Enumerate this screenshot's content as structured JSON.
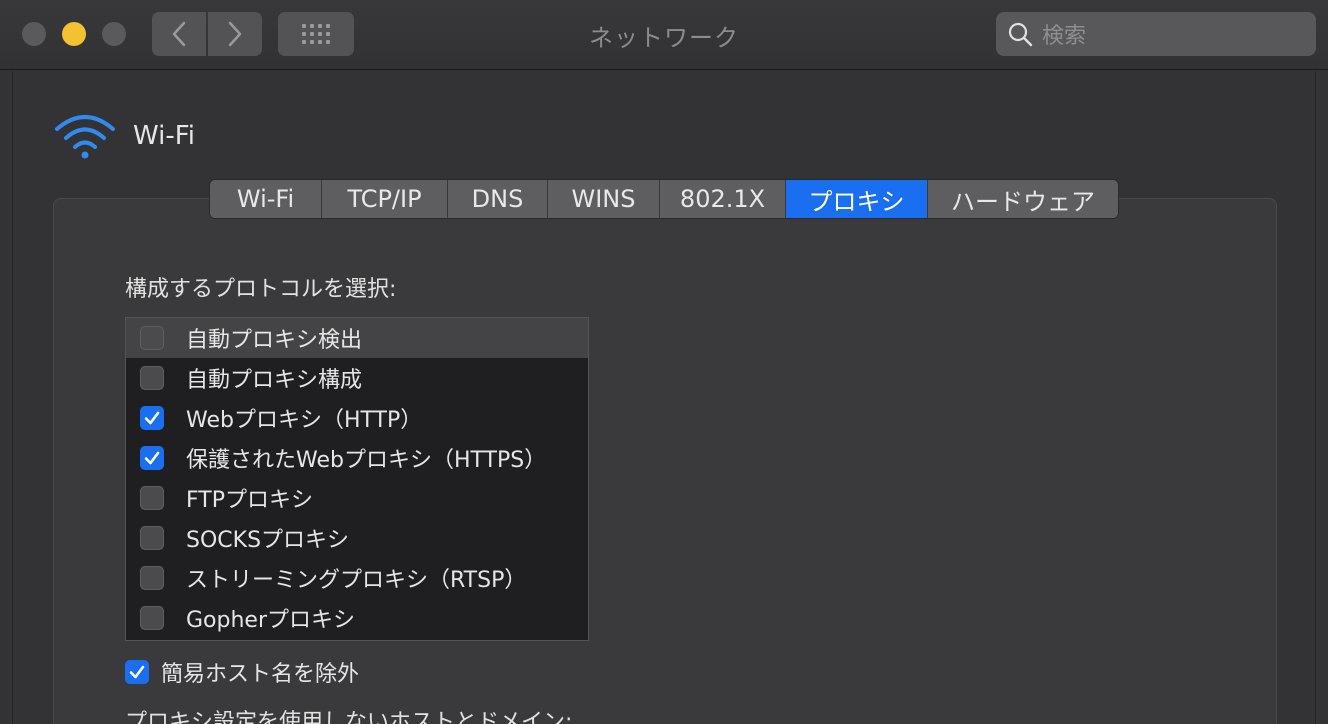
{
  "window": {
    "title": "ネットワーク",
    "search": {
      "placeholder": "検索"
    }
  },
  "interface": {
    "name": "Wi-Fi",
    "icon": "wifi-icon"
  },
  "tabs": [
    {
      "label": "Wi-Fi",
      "active": false
    },
    {
      "label": "TCP/IP",
      "active": false
    },
    {
      "label": "DNS",
      "active": false
    },
    {
      "label": "WINS",
      "active": false
    },
    {
      "label": "802.1X",
      "active": false
    },
    {
      "label": "プロキシ",
      "active": true
    },
    {
      "label": "ハードウェア",
      "active": false
    }
  ],
  "proxy": {
    "section_label": "構成するプロトコルを選択:",
    "protocols": [
      {
        "label": "自動プロキシ検出",
        "checked": false,
        "selected": true
      },
      {
        "label": "自動プロキシ構成",
        "checked": false,
        "selected": false
      },
      {
        "label": "Webプロキシ（HTTP）",
        "checked": true,
        "selected": false
      },
      {
        "label": "保護されたWebプロキシ（HTTPS）",
        "checked": true,
        "selected": false
      },
      {
        "label": "FTPプロキシ",
        "checked": false,
        "selected": false
      },
      {
        "label": "SOCKSプロキシ",
        "checked": false,
        "selected": false
      },
      {
        "label": "ストリーミングプロキシ（RTSP）",
        "checked": false,
        "selected": false
      },
      {
        "label": "Gopherプロキシ",
        "checked": false,
        "selected": false
      }
    ],
    "exclude_simple": {
      "label": "簡易ホスト名を除外",
      "checked": true
    },
    "bypass_label": "プロキシ設定を使用しないホストとドメイン:"
  },
  "colors": {
    "accent": "#1a6ff0",
    "traffic_minimize": "#f2c230",
    "wifi_icon": "#2f8bf0"
  }
}
